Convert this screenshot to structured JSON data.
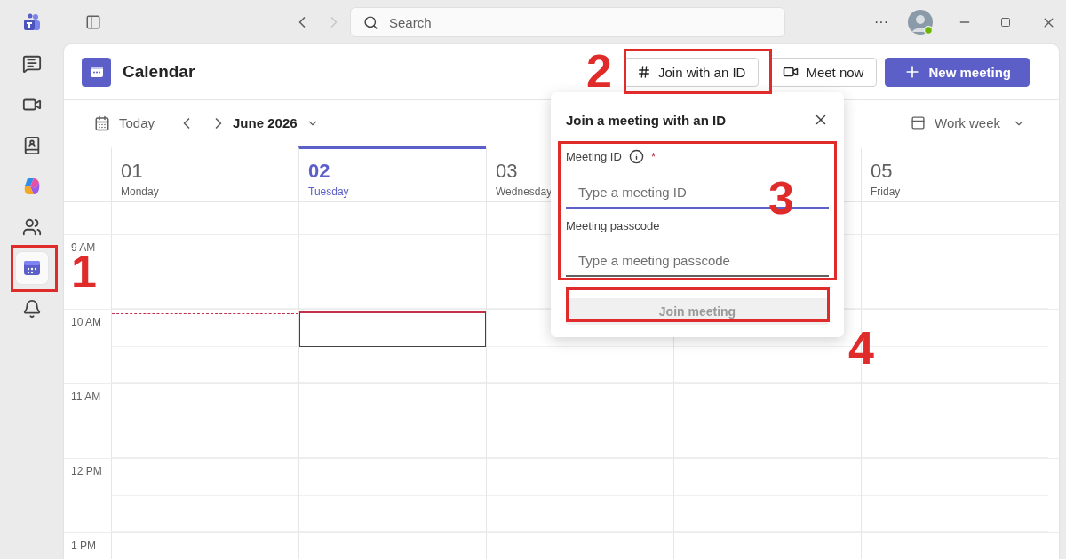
{
  "app_bar": {
    "items": [
      {
        "kind": "logo",
        "selected": false
      },
      {
        "kind": "chat",
        "selected": false
      },
      {
        "kind": "video",
        "selected": false
      },
      {
        "kind": "contacts",
        "selected": false
      },
      {
        "kind": "copilot",
        "selected": false
      },
      {
        "kind": "communities",
        "selected": false
      },
      {
        "kind": "calendar",
        "selected": true
      },
      {
        "kind": "activity",
        "selected": false
      }
    ]
  },
  "title_bar": {
    "search": {
      "placeholder": "Search"
    },
    "more": "···"
  },
  "calendar": {
    "title": "Calendar",
    "buttons": [
      {
        "kind": "join",
        "label": "Join with an ID"
      },
      {
        "kind": "meet",
        "label": "Meet now"
      },
      {
        "kind": "new",
        "label": "New meeting"
      }
    ],
    "toolbar": {
      "today": "Today",
      "month": "June 2026",
      "view": "Work week"
    },
    "days": [
      {
        "date": "01",
        "name": "Monday",
        "selected": false
      },
      {
        "date": "02",
        "name": "Tuesday",
        "selected": true
      },
      {
        "date": "03",
        "name": "Wednesday",
        "selected": false
      },
      {
        "date": "05",
        "name": "Friday",
        "selected": false
      }
    ],
    "hours": [
      {
        "label": "9 AM",
        "selected": false
      },
      {
        "label": "10 AM",
        "selected": true
      },
      {
        "label": "11 AM",
        "selected": false
      },
      {
        "label": "12 PM",
        "selected": false
      },
      {
        "label": "1 PM",
        "selected": false
      }
    ]
  },
  "join_dialog": {
    "title": "Join a meeting with an ID",
    "fields": [
      {
        "label": "Meeting ID",
        "required": true,
        "required_mark": "*",
        "placeholder": "Type a meeting ID",
        "focused": true
      },
      {
        "label": "Meeting passcode",
        "required": false,
        "placeholder": "Type a meeting passcode",
        "focused": false
      }
    ],
    "button": {
      "label": "Join meeting",
      "disabled": true
    }
  },
  "annotations": [
    {
      "label": "1"
    },
    {
      "label": "2"
    },
    {
      "label": "3"
    },
    {
      "label": "4"
    }
  ]
}
